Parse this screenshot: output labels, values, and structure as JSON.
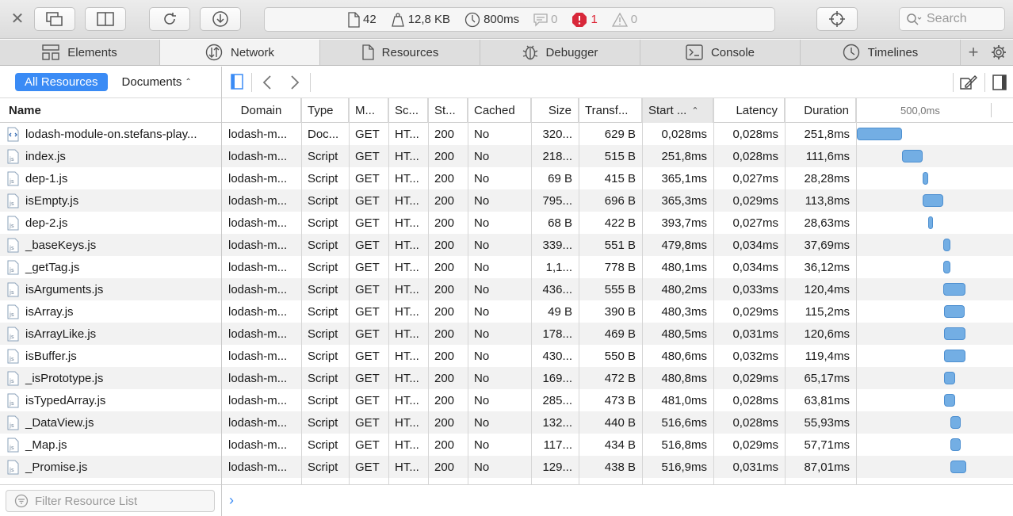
{
  "toolbar": {
    "stats": {
      "resources_count": "42",
      "size": "12,8 KB",
      "load_time": "800ms",
      "messages": "0",
      "errors": "1",
      "warnings": "0"
    },
    "search_placeholder": "Search"
  },
  "tabs": [
    {
      "label": "Elements",
      "icon": "elements-icon"
    },
    {
      "label": "Network",
      "icon": "network-icon",
      "active": true
    },
    {
      "label": "Resources",
      "icon": "resources-icon"
    },
    {
      "label": "Debugger",
      "icon": "debugger-icon"
    },
    {
      "label": "Console",
      "icon": "console-icon"
    },
    {
      "label": "Timelines",
      "icon": "timelines-icon"
    }
  ],
  "sidebar": {
    "scope_all": "All Resources",
    "scope_filter": "Documents",
    "name_header": "Name",
    "filter_placeholder": "Filter Resource List"
  },
  "grid": {
    "headers": {
      "domain": "Domain",
      "type": "Type",
      "method": "M...",
      "scheme": "Sc...",
      "status": "St...",
      "cached": "Cached",
      "size": "Size",
      "transferred": "Transf...",
      "start": "Start ...",
      "latency": "Latency",
      "duration": "Duration"
    },
    "waterfall_label": "500,0ms",
    "rows": [
      {
        "name": "lodash-module-on.stefans-play...",
        "kind": "doc",
        "domain": "lodash-m...",
        "type": "Doc...",
        "method": "GET",
        "scheme": "HT...",
        "status": "200",
        "cached": "No",
        "size": "320...",
        "transferred": "629 B",
        "start": "0,028ms",
        "latency": "0,028ms",
        "duration": "251,8ms"
      },
      {
        "name": "index.js",
        "kind": "js",
        "domain": "lodash-m...",
        "type": "Script",
        "method": "GET",
        "scheme": "HT...",
        "status": "200",
        "cached": "No",
        "size": "218...",
        "transferred": "515 B",
        "start": "251,8ms",
        "latency": "0,028ms",
        "duration": "111,6ms"
      },
      {
        "name": "dep-1.js",
        "kind": "js",
        "domain": "lodash-m...",
        "type": "Script",
        "method": "GET",
        "scheme": "HT...",
        "status": "200",
        "cached": "No",
        "size": "69 B",
        "transferred": "415 B",
        "start": "365,1ms",
        "latency": "0,027ms",
        "duration": "28,28ms"
      },
      {
        "name": "isEmpty.js",
        "kind": "js",
        "domain": "lodash-m...",
        "type": "Script",
        "method": "GET",
        "scheme": "HT...",
        "status": "200",
        "cached": "No",
        "size": "795...",
        "transferred": "696 B",
        "start": "365,3ms",
        "latency": "0,029ms",
        "duration": "113,8ms"
      },
      {
        "name": "dep-2.js",
        "kind": "js",
        "domain": "lodash-m...",
        "type": "Script",
        "method": "GET",
        "scheme": "HT...",
        "status": "200",
        "cached": "No",
        "size": "68 B",
        "transferred": "422 B",
        "start": "393,7ms",
        "latency": "0,027ms",
        "duration": "28,63ms"
      },
      {
        "name": "_baseKeys.js",
        "kind": "js",
        "domain": "lodash-m...",
        "type": "Script",
        "method": "GET",
        "scheme": "HT...",
        "status": "200",
        "cached": "No",
        "size": "339...",
        "transferred": "551 B",
        "start": "479,8ms",
        "latency": "0,034ms",
        "duration": "37,69ms"
      },
      {
        "name": "_getTag.js",
        "kind": "js",
        "domain": "lodash-m...",
        "type": "Script",
        "method": "GET",
        "scheme": "HT...",
        "status": "200",
        "cached": "No",
        "size": "1,1...",
        "transferred": "778 B",
        "start": "480,1ms",
        "latency": "0,034ms",
        "duration": "36,12ms"
      },
      {
        "name": "isArguments.js",
        "kind": "js",
        "domain": "lodash-m...",
        "type": "Script",
        "method": "GET",
        "scheme": "HT...",
        "status": "200",
        "cached": "No",
        "size": "436...",
        "transferred": "555 B",
        "start": "480,2ms",
        "latency": "0,033ms",
        "duration": "120,4ms"
      },
      {
        "name": "isArray.js",
        "kind": "js",
        "domain": "lodash-m...",
        "type": "Script",
        "method": "GET",
        "scheme": "HT...",
        "status": "200",
        "cached": "No",
        "size": "49 B",
        "transferred": "390 B",
        "start": "480,3ms",
        "latency": "0,029ms",
        "duration": "115,2ms"
      },
      {
        "name": "isArrayLike.js",
        "kind": "js",
        "domain": "lodash-m...",
        "type": "Script",
        "method": "GET",
        "scheme": "HT...",
        "status": "200",
        "cached": "No",
        "size": "178...",
        "transferred": "469 B",
        "start": "480,5ms",
        "latency": "0,031ms",
        "duration": "120,6ms"
      },
      {
        "name": "isBuffer.js",
        "kind": "js",
        "domain": "lodash-m...",
        "type": "Script",
        "method": "GET",
        "scheme": "HT...",
        "status": "200",
        "cached": "No",
        "size": "430...",
        "transferred": "550 B",
        "start": "480,6ms",
        "latency": "0,032ms",
        "duration": "119,4ms"
      },
      {
        "name": "_isPrototype.js",
        "kind": "js",
        "domain": "lodash-m...",
        "type": "Script",
        "method": "GET",
        "scheme": "HT...",
        "status": "200",
        "cached": "No",
        "size": "169...",
        "transferred": "472 B",
        "start": "480,8ms",
        "latency": "0,029ms",
        "duration": "65,17ms"
      },
      {
        "name": "isTypedArray.js",
        "kind": "js",
        "domain": "lodash-m...",
        "type": "Script",
        "method": "GET",
        "scheme": "HT...",
        "status": "200",
        "cached": "No",
        "size": "285...",
        "transferred": "473 B",
        "start": "481,0ms",
        "latency": "0,028ms",
        "duration": "63,81ms"
      },
      {
        "name": "_DataView.js",
        "kind": "js",
        "domain": "lodash-m...",
        "type": "Script",
        "method": "GET",
        "scheme": "HT...",
        "status": "200",
        "cached": "No",
        "size": "132...",
        "transferred": "440 B",
        "start": "516,6ms",
        "latency": "0,028ms",
        "duration": "55,93ms"
      },
      {
        "name": "_Map.js",
        "kind": "js",
        "domain": "lodash-m...",
        "type": "Script",
        "method": "GET",
        "scheme": "HT...",
        "status": "200",
        "cached": "No",
        "size": "117...",
        "transferred": "434 B",
        "start": "516,8ms",
        "latency": "0,029ms",
        "duration": "57,71ms"
      },
      {
        "name": "_Promise.js",
        "kind": "js",
        "domain": "lodash-m...",
        "type": "Script",
        "method": "GET",
        "scheme": "HT...",
        "status": "200",
        "cached": "No",
        "size": "129...",
        "transferred": "438 B",
        "start": "516,9ms",
        "latency": "0,031ms",
        "duration": "87,01ms"
      }
    ]
  }
}
